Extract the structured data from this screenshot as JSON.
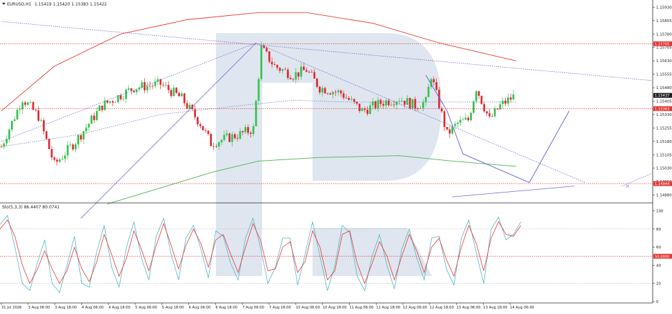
{
  "chart_data": [
    {
      "type": "candlestick",
      "symbol_header": "EURUSD,H1",
      "ohlc_header": "1.15419 1.15420 1.15383 1.15422",
      "price_axis": {
        "ticks": [
          "1.15930",
          "1.15855",
          "1.15780",
          "1.15705",
          "1.15630",
          "1.15555",
          "1.15480",
          "1.15405",
          "1.15330",
          "1.15255",
          "1.15180",
          "1.15105",
          "1.15030",
          "1.14955",
          "1.14880"
        ],
        "range": [
          1.1484,
          1.1597
        ]
      },
      "x_axis_labels": [
        "31 Jul 2026",
        "3 Aug 06:00",
        "3 Aug 18:00",
        "4 Aug 06:00",
        "4 Aug 18:00",
        "5 Aug 06:00",
        "5 Aug 18:00",
        "6 Aug 06:00",
        "6 Aug 18:00",
        "7 Aug 06:00",
        "7 Aug 18:00",
        "10 Aug 06:00",
        "10 Aug 18:00",
        "11 Aug 06:00",
        "11 Aug 18:00",
        "12 Aug 06:00",
        "12 Aug 18:00",
        "13 Aug 06:00",
        "13 Aug 18:00",
        "14 Aug 06:00"
      ],
      "price_labels": [
        {
          "text": "1.15705",
          "value": 1.15725,
          "color": "#e53935"
        },
        {
          "text": "1.15437",
          "value": 1.15437,
          "color": "#1f1f1f"
        },
        {
          "text": "1.15363",
          "value": 1.15363,
          "color": "#e53935"
        },
        {
          "text": "1.14944",
          "value": 1.14944,
          "color": "#e53935"
        }
      ],
      "key_closes": [
        {
          "bar": 0,
          "close": 1.1515
        },
        {
          "bar": 8,
          "close": 1.1542
        },
        {
          "bar": 14,
          "close": 1.1532
        },
        {
          "bar": 20,
          "close": 1.1505
        },
        {
          "bar": 28,
          "close": 1.1518
        },
        {
          "bar": 38,
          "close": 1.1538
        },
        {
          "bar": 50,
          "close": 1.1548
        },
        {
          "bar": 60,
          "close": 1.155
        },
        {
          "bar": 68,
          "close": 1.1542
        },
        {
          "bar": 75,
          "close": 1.1528
        },
        {
          "bar": 79,
          "close": 1.1517
        },
        {
          "bar": 90,
          "close": 1.1522
        },
        {
          "bar": 95,
          "close": 1.1525
        },
        {
          "bar": 98,
          "close": 1.157
        },
        {
          "bar": 103,
          "close": 1.156
        },
        {
          "bar": 110,
          "close": 1.1555
        },
        {
          "bar": 115,
          "close": 1.1558
        },
        {
          "bar": 120,
          "close": 1.1548
        },
        {
          "bar": 128,
          "close": 1.1545
        },
        {
          "bar": 136,
          "close": 1.1535
        },
        {
          "bar": 144,
          "close": 1.154
        },
        {
          "bar": 150,
          "close": 1.1542
        },
        {
          "bar": 156,
          "close": 1.1538
        },
        {
          "bar": 160,
          "close": 1.154
        },
        {
          "bar": 162,
          "close": 1.1555
        },
        {
          "bar": 168,
          "close": 1.1522
        },
        {
          "bar": 172,
          "close": 1.1528
        },
        {
          "bar": 176,
          "close": 1.153
        },
        {
          "bar": 179,
          "close": 1.1548
        },
        {
          "bar": 184,
          "close": 1.153
        },
        {
          "bar": 188,
          "close": 1.1538
        },
        {
          "bar": 193,
          "close": 1.1543
        }
      ],
      "moving_averages": [
        {
          "color": "#e53935",
          "points": [
            [
              0,
              1.1535
            ],
            [
              20,
              1.156
            ],
            [
              45,
              1.1578
            ],
            [
              70,
              1.1586
            ],
            [
              97,
              1.159
            ],
            [
              115,
              1.159
            ],
            [
              140,
              1.1584
            ],
            [
              165,
              1.1573
            ],
            [
              194,
              1.1563
            ]
          ]
        },
        {
          "color": "#4caf50",
          "points": [
            [
              40,
              1.1483
            ],
            [
              60,
              1.1492
            ],
            [
              80,
              1.1501
            ],
            [
              97,
              1.1507
            ],
            [
              120,
              1.1509
            ],
            [
              150,
              1.151
            ],
            [
              170,
              1.1507
            ],
            [
              194,
              1.1504
            ]
          ]
        },
        {
          "color": "#8f8fc8",
          "dashed": true,
          "points": [
            [
              0,
              1.1515
            ],
            [
              30,
              1.1522
            ],
            [
              60,
              1.1533
            ],
            [
              90,
              1.1538
            ],
            [
              110,
              1.1541
            ],
            [
              130,
              1.154
            ],
            [
              160,
              1.154
            ],
            [
              194,
              1.154
            ]
          ]
        }
      ],
      "trendlines": [
        {
          "color": "#6a6ad6",
          "dashed": true,
          "from": [
            0,
            1.1585
          ],
          "to": [
            245,
            1.1552
          ]
        },
        {
          "color": "#6a6ad6",
          "dashed": true,
          "from": [
            0,
            1.1518
          ],
          "to": [
            96,
            1.1573
          ]
        },
        {
          "color": "#6a6ad6",
          "dashed": true,
          "from": [
            96,
            1.1573
          ],
          "to": [
            220,
            1.1495
          ]
        },
        {
          "color": "#6a6ad6",
          "dashed": false,
          "from": [
            30,
            1.1475
          ],
          "to": [
            96,
            1.1573
          ]
        },
        {
          "color": "#6a6ad6",
          "dashed": false,
          "from": [
            170,
            1.1487
          ],
          "to": [
            216,
            1.1493
          ]
        },
        {
          "color": "#6a6ad6",
          "dashed": true,
          "from": [
            234,
            1.1493
          ],
          "to": [
            245,
            1.15
          ]
        }
      ],
      "forecast_path": {
        "color": "#6a6ad6",
        "points": [
          [
            160,
            1.1555
          ],
          [
            168,
            1.1535
          ],
          [
            174,
            1.1511
          ],
          [
            199,
            1.1495
          ],
          [
            214,
            1.1535
          ]
        ]
      },
      "forecast_cross": [
        236,
        1.1493
      ]
    },
    {
      "type": "line",
      "title": "Sto(5,3,3) 86.4407 80.0741",
      "y_ticks": [
        "100",
        "80",
        "60",
        "40",
        "20",
        "0"
      ],
      "ylim": [
        0,
        105
      ],
      "overbought_label": "80",
      "oversold_label": "20",
      "level_label": "50.0000",
      "level_value": 50,
      "series": [
        {
          "color": "#4fb6c8",
          "values": [
            85,
            95,
            60,
            20,
            12,
            42,
            68,
            20,
            10,
            40,
            72,
            20,
            16,
            55,
            84,
            38,
            16,
            60,
            88,
            48,
            24,
            72,
            92,
            52,
            24,
            70,
            84,
            58,
            26,
            78,
            72,
            42,
            24,
            70,
            92,
            60,
            20,
            38,
            70,
            70,
            18,
            52,
            88,
            50,
            12,
            40,
            84,
            76,
            28,
            12,
            50,
            74,
            40,
            14,
            58,
            80,
            48,
            24,
            70,
            72,
            36,
            18,
            70,
            90,
            54,
            20,
            80,
            93,
            68,
            74,
            88
          ]
        },
        {
          "color": "#e53935",
          "values": [
            80,
            90,
            72,
            40,
            20,
            35,
            56,
            36,
            20,
            34,
            60,
            36,
            22,
            44,
            74,
            52,
            28,
            48,
            78,
            58,
            34,
            62,
            86,
            62,
            36,
            62,
            80,
            64,
            38,
            68,
            74,
            52,
            32,
            60,
            86,
            68,
            34,
            36,
            60,
            66,
            32,
            44,
            78,
            60,
            24,
            34,
            74,
            78,
            42,
            20,
            42,
            66,
            50,
            24,
            50,
            74,
            56,
            32,
            60,
            70,
            46,
            28,
            60,
            84,
            64,
            34,
            70,
            88,
            74,
            72,
            84
          ]
        }
      ]
    }
  ],
  "watermark": {
    "shape": "logo"
  },
  "header_icon": "triangle-down-icon"
}
